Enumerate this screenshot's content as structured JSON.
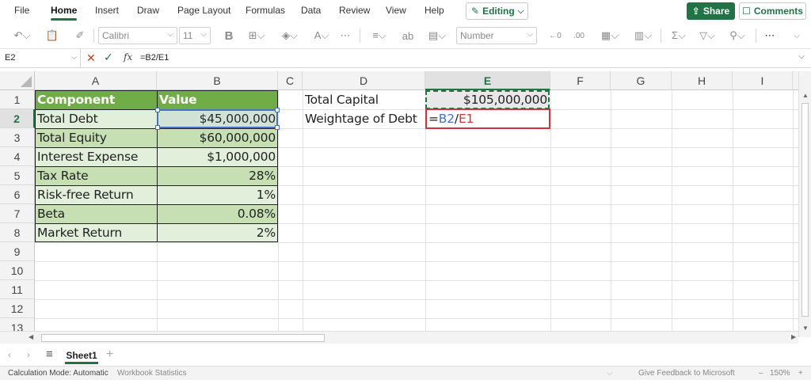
{
  "menu": {
    "items": [
      "File",
      "Home",
      "Insert",
      "Draw",
      "Page Layout",
      "Formulas",
      "Data",
      "Review",
      "View",
      "Help"
    ],
    "active": "Home",
    "editing_label": "Editing",
    "share_label": "Share",
    "comments_label": "Comments"
  },
  "toolbar": {
    "font_name": "Calibri",
    "font_size": "11",
    "number_format": "Number"
  },
  "formula_bar": {
    "name_box": "E2",
    "fx_label": "fx",
    "formula": "=B2/E1"
  },
  "columns": [
    "A",
    "B",
    "C",
    "D",
    "E",
    "F",
    "G",
    "H",
    "I"
  ],
  "rows": [
    "1",
    "2",
    "3",
    "4",
    "5",
    "6",
    "7",
    "8",
    "9",
    "10",
    "11",
    "12",
    "13"
  ],
  "selected_column": "E",
  "selected_row": "2",
  "table": {
    "header": [
      "Component",
      "Value"
    ],
    "rows": [
      [
        "Total Debt",
        "$45,000,000"
      ],
      [
        "Total Equity",
        "$60,000,000"
      ],
      [
        "Interest Expense",
        "$1,000,000"
      ],
      [
        "Tax Rate",
        "28%"
      ],
      [
        "Risk-free Return",
        "1%"
      ],
      [
        "Beta",
        "0.08%"
      ],
      [
        "Market Return",
        "2%"
      ]
    ]
  },
  "side": {
    "d1": "Total Capital",
    "e1": "$105,000,000",
    "d2": "Weightage of Debt",
    "e2_eq": "=",
    "e2_ref1": "B2",
    "e2_slash": "/",
    "e2_ref2": "E1"
  },
  "colors": {
    "accent": "#217346",
    "table_header": "#70ad47",
    "table_light": "#e2efda",
    "table_dark": "#c6e0b4",
    "ref_blue": "#4472c4",
    "ref_red": "#d13438"
  },
  "sheet": {
    "tab_name": "Sheet1"
  },
  "status": {
    "calc_mode": "Calculation Mode: Automatic",
    "workbook_stats": "Workbook Statistics",
    "feedback": "Give Feedback to Microsoft",
    "zoom": "150%",
    "zoom_minus": "–",
    "zoom_plus": "+"
  }
}
